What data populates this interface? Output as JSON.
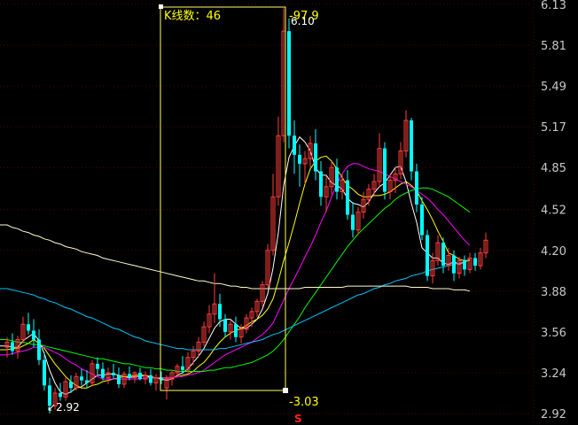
{
  "chart_data": {
    "type": "candlestick",
    "y_axis": {
      "tick_labels": [
        "6.13",
        "5.81",
        "5.49",
        "5.17",
        "4.85",
        "4.52",
        "4.20",
        "3.88",
        "3.56",
        "3.24",
        "2.92"
      ],
      "ylim": [
        2.92,
        6.13
      ],
      "side": "right"
    },
    "grid": true,
    "selection": {
      "label": "K线数：46",
      "change": "97.9",
      "high_label": "6.10",
      "low_label": "3.03",
      "marker": "S"
    },
    "min_label": "2.92",
    "colors": {
      "background": "#000000",
      "up": "#ff3b3b",
      "down": "#00ffff",
      "selection_box": "#ffff66",
      "grid": "#5a0000",
      "ma_5": "#ffffff",
      "ma_10": "#ffff00",
      "ma_20": "#ff00ff",
      "ma_60": "#00ff00",
      "ma_120": "#00c8ff",
      "ma_250": "#ffffcc"
    },
    "candles": [
      {
        "o": 3.44,
        "h": 3.52,
        "l": 3.36,
        "c": 3.48
      },
      {
        "o": 3.48,
        "h": 3.55,
        "l": 3.38,
        "c": 3.41
      },
      {
        "o": 3.41,
        "h": 3.53,
        "l": 3.35,
        "c": 3.5
      },
      {
        "o": 3.5,
        "h": 3.68,
        "l": 3.47,
        "c": 3.62
      },
      {
        "o": 3.62,
        "h": 3.71,
        "l": 3.54,
        "c": 3.57
      },
      {
        "o": 3.57,
        "h": 3.66,
        "l": 3.44,
        "c": 3.5
      },
      {
        "o": 3.5,
        "h": 3.58,
        "l": 3.3,
        "c": 3.34
      },
      {
        "o": 3.34,
        "h": 3.4,
        "l": 3.1,
        "c": 3.14
      },
      {
        "o": 3.14,
        "h": 3.2,
        "l": 2.92,
        "c": 2.98
      },
      {
        "o": 2.98,
        "h": 3.12,
        "l": 2.95,
        "c": 3.08
      },
      {
        "o": 3.08,
        "h": 3.16,
        "l": 3.02,
        "c": 3.05
      },
      {
        "o": 3.05,
        "h": 3.2,
        "l": 3.02,
        "c": 3.17
      },
      {
        "o": 3.17,
        "h": 3.22,
        "l": 3.08,
        "c": 3.12
      },
      {
        "o": 3.12,
        "h": 3.24,
        "l": 3.1,
        "c": 3.21
      },
      {
        "o": 3.21,
        "h": 3.27,
        "l": 3.14,
        "c": 3.18
      },
      {
        "o": 3.18,
        "h": 3.26,
        "l": 3.12,
        "c": 3.16
      },
      {
        "o": 3.16,
        "h": 3.34,
        "l": 3.14,
        "c": 3.31
      },
      {
        "o": 3.31,
        "h": 3.36,
        "l": 3.22,
        "c": 3.27
      },
      {
        "o": 3.27,
        "h": 3.32,
        "l": 3.18,
        "c": 3.2
      },
      {
        "o": 3.2,
        "h": 3.28,
        "l": 3.15,
        "c": 3.24
      },
      {
        "o": 3.24,
        "h": 3.31,
        "l": 3.19,
        "c": 3.22
      },
      {
        "o": 3.22,
        "h": 3.28,
        "l": 3.12,
        "c": 3.15
      },
      {
        "o": 3.15,
        "h": 3.25,
        "l": 3.12,
        "c": 3.23
      },
      {
        "o": 3.23,
        "h": 3.29,
        "l": 3.18,
        "c": 3.2
      },
      {
        "o": 3.2,
        "h": 3.25,
        "l": 3.16,
        "c": 3.24
      },
      {
        "o": 3.24,
        "h": 3.28,
        "l": 3.18,
        "c": 3.19
      },
      {
        "o": 3.19,
        "h": 3.25,
        "l": 3.15,
        "c": 3.22
      },
      {
        "o": 3.22,
        "h": 3.27,
        "l": 3.14,
        "c": 3.16
      },
      {
        "o": 3.16,
        "h": 3.23,
        "l": 3.1,
        "c": 3.2
      },
      {
        "o": 3.2,
        "h": 3.25,
        "l": 3.15,
        "c": 3.18
      },
      {
        "o": 3.12,
        "h": 3.22,
        "l": 3.03,
        "c": 3.19
      },
      {
        "o": 3.19,
        "h": 3.26,
        "l": 3.14,
        "c": 3.24
      },
      {
        "o": 3.24,
        "h": 3.31,
        "l": 3.2,
        "c": 3.29
      },
      {
        "o": 3.29,
        "h": 3.37,
        "l": 3.23,
        "c": 3.26
      },
      {
        "o": 3.26,
        "h": 3.4,
        "l": 3.24,
        "c": 3.36
      },
      {
        "o": 3.36,
        "h": 3.45,
        "l": 3.3,
        "c": 3.41
      },
      {
        "o": 3.41,
        "h": 3.52,
        "l": 3.36,
        "c": 3.48
      },
      {
        "o": 3.48,
        "h": 3.64,
        "l": 3.45,
        "c": 3.6
      },
      {
        "o": 3.6,
        "h": 3.77,
        "l": 3.55,
        "c": 3.7
      },
      {
        "o": 3.7,
        "h": 4.02,
        "l": 3.63,
        "c": 3.78
      },
      {
        "o": 3.78,
        "h": 3.86,
        "l": 3.6,
        "c": 3.66
      },
      {
        "o": 3.66,
        "h": 3.7,
        "l": 3.52,
        "c": 3.56
      },
      {
        "o": 3.56,
        "h": 3.66,
        "l": 3.5,
        "c": 3.62
      },
      {
        "o": 3.62,
        "h": 3.68,
        "l": 3.48,
        "c": 3.52
      },
      {
        "o": 3.52,
        "h": 3.62,
        "l": 3.47,
        "c": 3.58
      },
      {
        "o": 3.58,
        "h": 3.7,
        "l": 3.55,
        "c": 3.67
      },
      {
        "o": 3.67,
        "h": 3.75,
        "l": 3.6,
        "c": 3.72
      },
      {
        "o": 3.72,
        "h": 3.82,
        "l": 3.68,
        "c": 3.8
      },
      {
        "o": 3.8,
        "h": 3.96,
        "l": 3.76,
        "c": 3.93
      },
      {
        "o": 3.93,
        "h": 4.25,
        "l": 3.9,
        "c": 4.2
      },
      {
        "o": 4.2,
        "h": 4.8,
        "l": 4.16,
        "c": 4.62
      },
      {
        "o": 4.62,
        "h": 5.25,
        "l": 4.55,
        "c": 5.1
      },
      {
        "o": 5.1,
        "h": 6.1,
        "l": 5.05,
        "c": 5.92
      },
      {
        "o": 5.92,
        "h": 6.02,
        "l": 5.0,
        "c": 5.1
      },
      {
        "o": 5.1,
        "h": 5.22,
        "l": 4.8,
        "c": 4.95
      },
      {
        "o": 4.95,
        "h": 5.03,
        "l": 4.7,
        "c": 4.88
      },
      {
        "o": 4.88,
        "h": 4.98,
        "l": 4.72,
        "c": 4.92
      },
      {
        "o": 4.92,
        "h": 5.1,
        "l": 4.85,
        "c": 5.04
      },
      {
        "o": 5.04,
        "h": 5.15,
        "l": 4.75,
        "c": 4.82
      },
      {
        "o": 4.82,
        "h": 4.9,
        "l": 4.55,
        "c": 4.62
      },
      {
        "o": 4.62,
        "h": 4.78,
        "l": 4.5,
        "c": 4.7
      },
      {
        "o": 4.7,
        "h": 4.9,
        "l": 4.64,
        "c": 4.85
      },
      {
        "o": 4.85,
        "h": 4.92,
        "l": 4.6,
        "c": 4.66
      },
      {
        "o": 4.66,
        "h": 4.8,
        "l": 4.6,
        "c": 4.75
      },
      {
        "o": 4.75,
        "h": 4.83,
        "l": 4.44,
        "c": 4.48
      },
      {
        "o": 4.48,
        "h": 4.58,
        "l": 4.3,
        "c": 4.36
      },
      {
        "o": 4.36,
        "h": 4.54,
        "l": 4.32,
        "c": 4.5
      },
      {
        "o": 4.5,
        "h": 4.66,
        "l": 4.45,
        "c": 4.6
      },
      {
        "o": 4.6,
        "h": 4.72,
        "l": 4.55,
        "c": 4.68
      },
      {
        "o": 4.68,
        "h": 4.8,
        "l": 4.62,
        "c": 4.74
      },
      {
        "o": 4.74,
        "h": 5.12,
        "l": 4.7,
        "c": 5.0
      },
      {
        "o": 5.0,
        "h": 5.05,
        "l": 4.6,
        "c": 4.66
      },
      {
        "o": 4.66,
        "h": 4.8,
        "l": 4.6,
        "c": 4.75
      },
      {
        "o": 4.75,
        "h": 4.85,
        "l": 4.65,
        "c": 4.8
      },
      {
        "o": 4.8,
        "h": 5.05,
        "l": 4.76,
        "c": 4.98
      },
      {
        "o": 4.98,
        "h": 5.3,
        "l": 4.93,
        "c": 5.22
      },
      {
        "o": 5.22,
        "h": 5.24,
        "l": 4.75,
        "c": 4.82
      },
      {
        "o": 4.82,
        "h": 4.88,
        "l": 4.5,
        "c": 4.56
      },
      {
        "o": 4.56,
        "h": 4.62,
        "l": 4.28,
        "c": 4.32
      },
      {
        "o": 4.32,
        "h": 4.36,
        "l": 3.96,
        "c": 4.0
      },
      {
        "o": 4.0,
        "h": 4.18,
        "l": 3.94,
        "c": 4.12
      },
      {
        "o": 4.12,
        "h": 4.32,
        "l": 4.08,
        "c": 4.26
      },
      {
        "o": 4.26,
        "h": 4.3,
        "l": 4.02,
        "c": 4.08
      },
      {
        "o": 4.08,
        "h": 4.22,
        "l": 4.04,
        "c": 4.16
      },
      {
        "o": 4.16,
        "h": 4.2,
        "l": 3.96,
        "c": 4.02
      },
      {
        "o": 4.02,
        "h": 4.15,
        "l": 3.98,
        "c": 4.12
      },
      {
        "o": 4.12,
        "h": 4.16,
        "l": 4.0,
        "c": 4.05
      },
      {
        "o": 4.05,
        "h": 4.18,
        "l": 4.02,
        "c": 4.14
      },
      {
        "o": 4.14,
        "h": 4.18,
        "l": 4.04,
        "c": 4.08
      },
      {
        "o": 4.08,
        "h": 4.22,
        "l": 4.05,
        "c": 4.18
      },
      {
        "o": 4.18,
        "h": 4.34,
        "l": 4.14,
        "c": 4.28
      }
    ],
    "moving_averages": [
      {
        "name": "MA5",
        "values": [
          3.45,
          3.44,
          3.44,
          3.49,
          3.52,
          3.55,
          3.49,
          3.39,
          3.26,
          3.16,
          3.09,
          3.07,
          3.09,
          3.12,
          3.13,
          3.16,
          3.19,
          3.22,
          3.22,
          3.23,
          3.23,
          3.22,
          3.21,
          3.2,
          3.21,
          3.21,
          3.22,
          3.2,
          3.2,
          3.19,
          3.18,
          3.19,
          3.22,
          3.24,
          3.27,
          3.32,
          3.37,
          3.43,
          3.51,
          3.59,
          3.64,
          3.66,
          3.66,
          3.62,
          3.59,
          3.59,
          3.62,
          3.66,
          3.74,
          3.86,
          4.06,
          4.34,
          4.71,
          4.93,
          5.02,
          5.09,
          5.05,
          4.98,
          4.85,
          4.79,
          4.79,
          4.73,
          4.71,
          4.68,
          4.61,
          4.57,
          4.56,
          4.54,
          4.58,
          4.65,
          4.7,
          4.73,
          4.79,
          4.85,
          4.86,
          4.74,
          4.57,
          4.42,
          4.22,
          4.18,
          4.14,
          4.14,
          4.1,
          4.09,
          4.11,
          4.09,
          4.11,
          4.13
        ]
      },
      {
        "name": "MA10",
        "values": [
          3.42,
          3.43,
          3.43,
          3.45,
          3.47,
          3.5,
          3.47,
          3.43,
          3.37,
          3.31,
          3.26,
          3.21,
          3.17,
          3.14,
          3.12,
          3.12,
          3.14,
          3.15,
          3.17,
          3.18,
          3.19,
          3.2,
          3.21,
          3.21,
          3.22,
          3.22,
          3.22,
          3.21,
          3.2,
          3.2,
          3.2,
          3.2,
          3.21,
          3.22,
          3.23,
          3.25,
          3.29,
          3.32,
          3.37,
          3.43,
          3.48,
          3.52,
          3.55,
          3.57,
          3.59,
          3.61,
          3.64,
          3.66,
          3.69,
          3.74,
          3.82,
          3.96,
          4.12,
          4.26,
          4.41,
          4.57,
          4.72,
          4.84,
          4.9,
          4.93,
          4.94,
          4.9,
          4.84,
          4.77,
          4.71,
          4.68,
          4.64,
          4.62,
          4.62,
          4.63,
          4.63,
          4.64,
          4.66,
          4.69,
          4.72,
          4.74,
          4.71,
          4.67,
          4.59,
          4.52,
          4.44,
          4.35,
          4.27,
          4.18,
          4.16,
          4.13,
          4.12,
          4.12
        ]
      },
      {
        "name": "MA20",
        "values": [
          3.38,
          3.39,
          3.4,
          3.41,
          3.42,
          3.44,
          3.44,
          3.44,
          3.42,
          3.4,
          3.38,
          3.35,
          3.32,
          3.3,
          3.27,
          3.25,
          3.23,
          3.21,
          3.19,
          3.19,
          3.19,
          3.19,
          3.19,
          3.19,
          3.19,
          3.19,
          3.2,
          3.2,
          3.2,
          3.2,
          3.2,
          3.2,
          3.21,
          3.21,
          3.22,
          3.23,
          3.24,
          3.26,
          3.29,
          3.32,
          3.35,
          3.38,
          3.4,
          3.42,
          3.44,
          3.46,
          3.48,
          3.51,
          3.54,
          3.58,
          3.63,
          3.72,
          3.81,
          3.9,
          3.98,
          4.06,
          4.15,
          4.23,
          4.32,
          4.42,
          4.51,
          4.62,
          4.72,
          4.8,
          4.86,
          4.88,
          4.88,
          4.86,
          4.84,
          4.83,
          4.82,
          4.8,
          4.78,
          4.76,
          4.74,
          4.72,
          4.7,
          4.67,
          4.64,
          4.61,
          4.57,
          4.52,
          4.48,
          4.43,
          4.38,
          4.33,
          4.28,
          4.24
        ]
      },
      {
        "name": "MA60",
        "values": [
          3.5,
          3.49,
          3.48,
          3.48,
          3.47,
          3.46,
          3.46,
          3.45,
          3.44,
          3.43,
          3.42,
          3.41,
          3.4,
          3.39,
          3.38,
          3.37,
          3.36,
          3.35,
          3.35,
          3.34,
          3.33,
          3.32,
          3.31,
          3.31,
          3.3,
          3.29,
          3.28,
          3.28,
          3.27,
          3.27,
          3.26,
          3.26,
          3.25,
          3.25,
          3.25,
          3.25,
          3.25,
          3.25,
          3.26,
          3.26,
          3.27,
          3.28,
          3.28,
          3.29,
          3.3,
          3.31,
          3.32,
          3.34,
          3.36,
          3.38,
          3.41,
          3.45,
          3.5,
          3.56,
          3.62,
          3.68,
          3.75,
          3.81,
          3.87,
          3.93,
          3.99,
          4.05,
          4.11,
          4.17,
          4.23,
          4.28,
          4.33,
          4.37,
          4.41,
          4.45,
          4.49,
          4.53,
          4.56,
          4.6,
          4.63,
          4.65,
          4.67,
          4.68,
          4.69,
          4.69,
          4.68,
          4.66,
          4.64,
          4.62,
          4.59,
          4.56,
          4.53,
          4.5
        ]
      },
      {
        "name": "MA120",
        "values": [
          3.9,
          3.89,
          3.88,
          3.87,
          3.86,
          3.85,
          3.83,
          3.82,
          3.8,
          3.79,
          3.77,
          3.75,
          3.74,
          3.72,
          3.7,
          3.68,
          3.67,
          3.65,
          3.63,
          3.61,
          3.59,
          3.58,
          3.56,
          3.54,
          3.52,
          3.51,
          3.49,
          3.48,
          3.47,
          3.46,
          3.45,
          3.44,
          3.43,
          3.43,
          3.42,
          3.42,
          3.42,
          3.42,
          3.42,
          3.42,
          3.43,
          3.43,
          3.44,
          3.45,
          3.46,
          3.47,
          3.48,
          3.49,
          3.5,
          3.52,
          3.54,
          3.55,
          3.57,
          3.59,
          3.61,
          3.63,
          3.65,
          3.67,
          3.69,
          3.71,
          3.73,
          3.75,
          3.77,
          3.79,
          3.81,
          3.83,
          3.85,
          3.86,
          3.88,
          3.9,
          3.91,
          3.93,
          3.94,
          3.96,
          3.97,
          3.98,
          4.0,
          4.01,
          4.02,
          4.04,
          4.05,
          4.06,
          4.07,
          4.08,
          4.09,
          4.1,
          4.11,
          4.12
        ]
      },
      {
        "name": "MA250",
        "values": [
          4.4,
          4.38,
          4.37,
          4.35,
          4.34,
          4.32,
          4.31,
          4.29,
          4.28,
          4.26,
          4.25,
          4.23,
          4.22,
          4.21,
          4.19,
          4.18,
          4.17,
          4.16,
          4.14,
          4.13,
          4.12,
          4.11,
          4.1,
          4.09,
          4.08,
          4.07,
          4.06,
          4.05,
          4.04,
          4.03,
          4.02,
          4.01,
          4.0,
          3.99,
          3.98,
          3.97,
          3.96,
          3.96,
          3.95,
          3.94,
          3.94,
          3.93,
          3.92,
          3.92,
          3.91,
          3.91,
          3.9,
          3.9,
          3.9,
          3.9,
          3.9,
          3.9,
          3.9,
          3.9,
          3.9,
          3.9,
          3.91,
          3.91,
          3.91,
          3.91,
          3.91,
          3.91,
          3.91,
          3.91,
          3.92,
          3.92,
          3.92,
          3.92,
          3.92,
          3.92,
          3.92,
          3.92,
          3.92,
          3.92,
          3.92,
          3.92,
          3.91,
          3.91,
          3.91,
          3.91,
          3.9,
          3.9,
          3.9,
          3.9,
          3.89,
          3.89,
          3.89,
          3.88
        ]
      }
    ]
  }
}
